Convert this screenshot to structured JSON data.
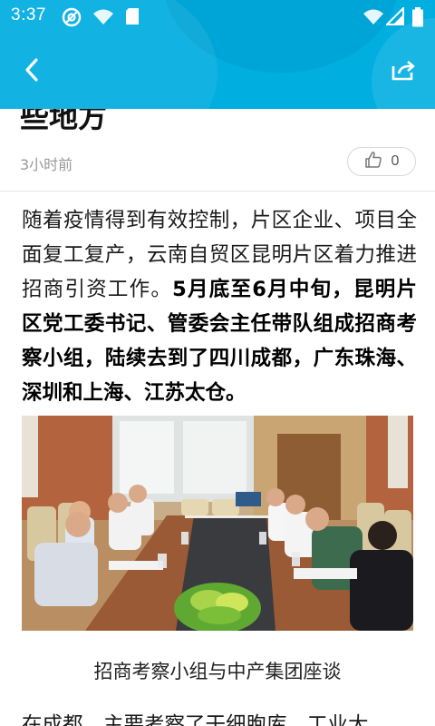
{
  "status_bar": {
    "time": "3:37",
    "icons": [
      "at-sign-icon",
      "wifi-question-icon",
      "sd-card-icon",
      "wifi-x-icon",
      "signal-icon",
      "battery-icon"
    ]
  },
  "toolbar": {
    "back_icon": "chevron-left-icon",
    "share_icon": "share-icon",
    "accent_color": "#00aee0"
  },
  "article": {
    "title_partial": "些地方",
    "published": "3小时前",
    "likes": "0",
    "paragraph_1_normal": "随着疫情得到有效控制，片区企业、项目全面复工复产，云南自贸区昆明片区着力推进招商引资工作。",
    "paragraph_1_bold": "5月底至6月中旬，昆明片区党工委书记、管委会主任带队组成招商考察小组，陆续去到了四川成都，广东珠海、深圳和上海、江苏太仓。",
    "image_caption": "招商考察小组与中产集团座谈",
    "paragraph_2_partial": "在成都，主要考察了干细胞库、工业大"
  }
}
